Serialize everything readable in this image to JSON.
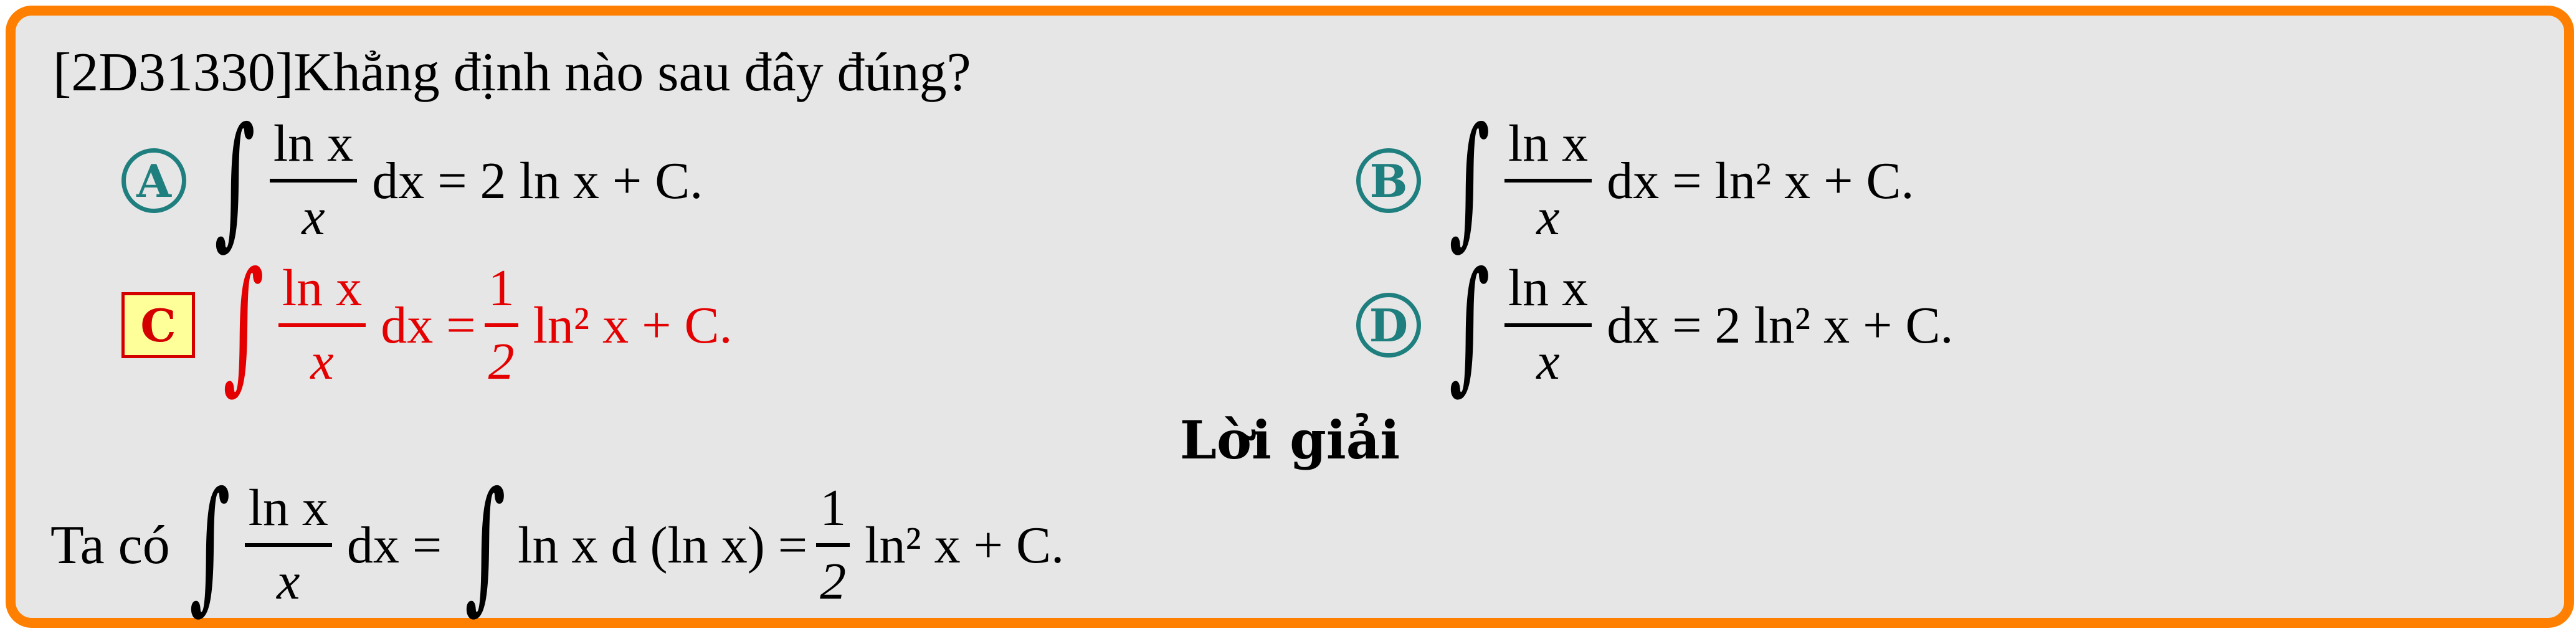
{
  "question": {
    "id": "[2D31330]",
    "text": "Khẳng định nào sau đây đúng?"
  },
  "options": [
    {
      "label": "A",
      "numerator": "ln x",
      "denominator": "x",
      "rhs": "dx = 2 ln x + C."
    },
    {
      "label": "B",
      "numerator": "ln x",
      "denominator": "x",
      "rhs": "dx = ln² x + C."
    },
    {
      "label": "C",
      "numerator": "ln x",
      "denominator": "x",
      "rhs": "dx =",
      "rhs_frac_num": "1",
      "rhs_frac_den": "2",
      "rhs_tail": "ln² x + C.",
      "correct": true
    },
    {
      "label": "D",
      "numerator": "ln x",
      "denominator": "x",
      "rhs": "dx = 2 ln² x + C."
    }
  ],
  "solution": {
    "heading": "Lời giải",
    "lead": "Ta có",
    "numerator": "ln x",
    "denominator": "x",
    "mid": "dx =",
    "integrand": "ln x d (ln x) =",
    "frac_num": "1",
    "frac_den": "2",
    "tail": "ln² x + C."
  },
  "colors": {
    "border": "#ff8000",
    "background": "#e6e6e6",
    "badge": "#1f7f7f",
    "correct": "#e40000",
    "correct_badge_bg": "#ffff99"
  }
}
